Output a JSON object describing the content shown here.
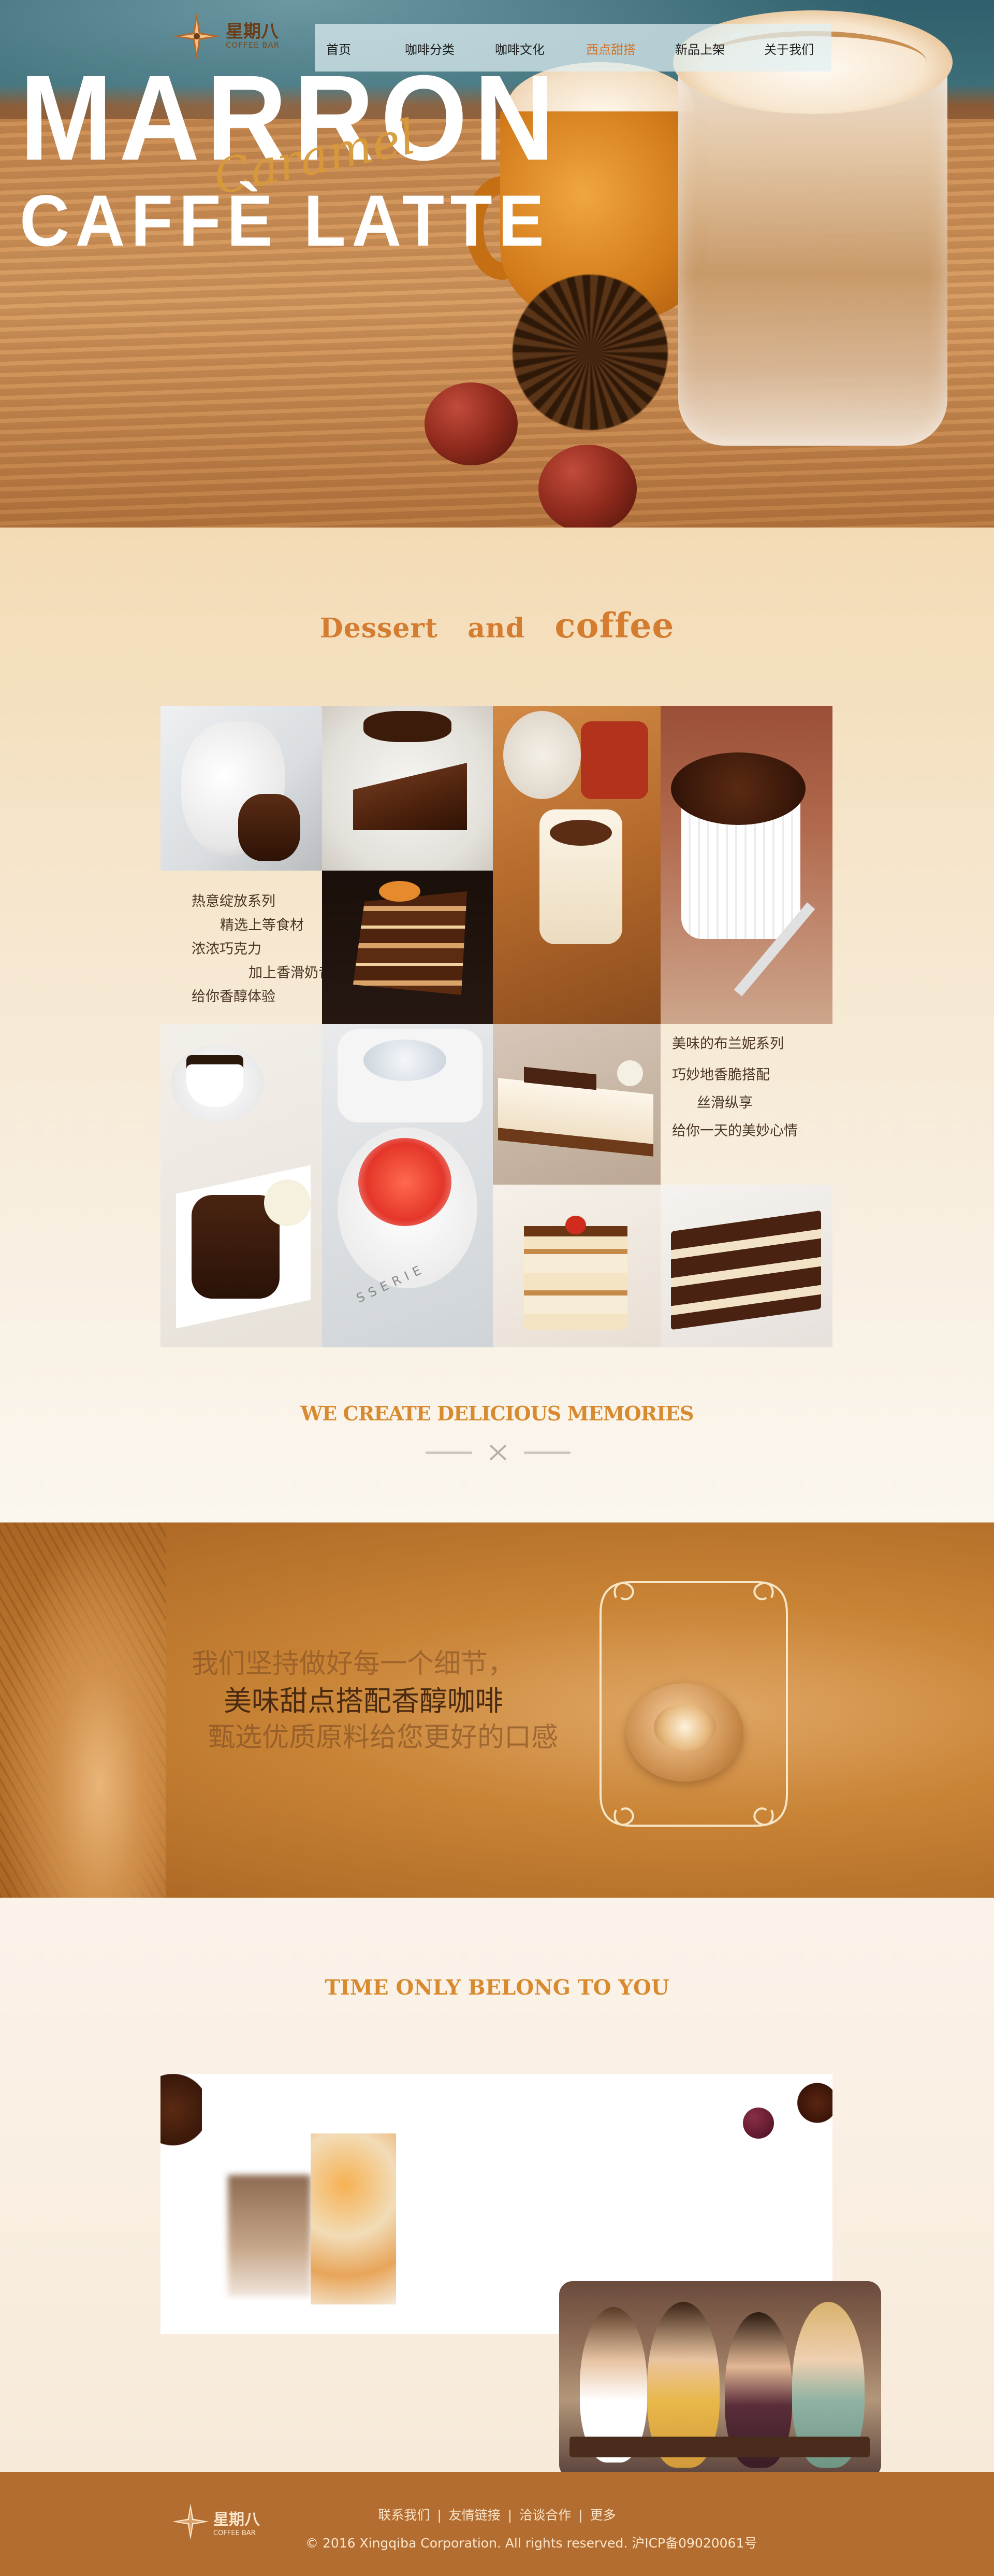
{
  "brand": {
    "name_cn": "星期八",
    "name_en": "COFFEE BAR"
  },
  "nav": {
    "items": [
      {
        "label": "首页"
      },
      {
        "label": "咖啡分类"
      },
      {
        "label": "咖啡文化"
      },
      {
        "label": "西点甜搭",
        "active": true
      },
      {
        "label": "新品上架"
      },
      {
        "label": "关于我们"
      }
    ]
  },
  "hero": {
    "title_line1": "MARRON",
    "title_script": "Caramel",
    "title_line2": "CAFFÈ LATTE"
  },
  "dessert": {
    "title_part1": "Dessert",
    "title_part2": "and",
    "title_part3": "coffee",
    "block1": [
      "热意绽放系列",
      "精选上等食材",
      "浓浓巧克力",
      "加上香滑奶昔",
      "给你香醇体验"
    ],
    "block2": [
      "美味的布兰妮系列",
      "巧妙地香脆搭配",
      "丝滑纵享",
      "给你一天的美妙心情"
    ],
    "memories": "WE CREATE DELICIOUS MEMORIES",
    "plate_text": "SSERIE"
  },
  "quote": {
    "line1": "我们坚持做好每一个细节，",
    "line2": "美味甜点搭配香醇咖啡",
    "line3": "甄选优质原料给您更好的口感"
  },
  "time": {
    "title": "TIME ONLY BELONG TO YOU"
  },
  "footer": {
    "links": [
      "联系我们",
      "友情链接",
      "洽谈合作",
      "更多"
    ],
    "copyright": "© 2016 Xingqiba Corporation. All rights reserved. 沪ICP备09020061号"
  },
  "colors": {
    "accent": "#d47c2f",
    "footer_bg": "#b36d30",
    "nav_active": "#d2752a"
  }
}
